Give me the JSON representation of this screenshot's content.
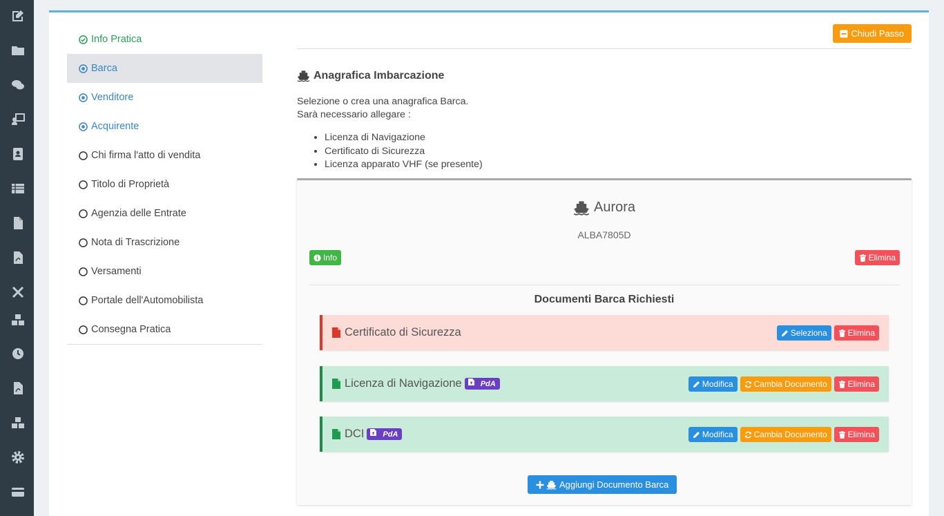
{
  "sidebar": {
    "icons": [
      "edit-icon",
      "folder-icon",
      "chat-icon",
      "presenter-icon",
      "address-book-icon",
      "list-table-icon",
      "file-icon",
      "pdf-file-icon",
      "tools-icon",
      "boxes-icon",
      "clock-icon",
      "pdf-file-icon-2",
      "boxes-icon-2",
      "gear-icon",
      "credit-card-icon"
    ]
  },
  "steps": [
    {
      "label": "Info Pratica",
      "state": "done"
    },
    {
      "label": "Barca",
      "state": "active"
    },
    {
      "label": "Venditore",
      "state": "current"
    },
    {
      "label": "Acquirente",
      "state": "current"
    },
    {
      "label": "Chi firma l'atto di vendita",
      "state": "todo"
    },
    {
      "label": "Titolo di Proprietà",
      "state": "todo"
    },
    {
      "label": "Agenzia delle Entrate",
      "state": "todo"
    },
    {
      "label": "Nota di Trascrizione",
      "state": "todo"
    },
    {
      "label": "Versamenti",
      "state": "todo"
    },
    {
      "label": "Portale dell'Automobilista",
      "state": "todo"
    },
    {
      "label": "Consegna Pratica",
      "state": "todo"
    }
  ],
  "header": {
    "close_step_label": "Chiudi Passo",
    "section_title": "Anagrafica Imbarcazione",
    "intro_line1": "Selezione o crea una anagrafica Barca.",
    "intro_line2": "Sarà necessario allegare :",
    "required": [
      "Licenza di Navigazione",
      "Certificato di Sicurezza",
      "Licenza apparato VHF (se presente)"
    ]
  },
  "boat": {
    "name": "Aurora",
    "code": "ALBA7805D",
    "info_label": "Info",
    "delete_label": "Elimina",
    "docs_title": "Documenti Barca Richiesti",
    "documents": [
      {
        "name": "Certificato di Sicurezza",
        "status": "missing",
        "badge": "",
        "actions": [
          "Seleziona",
          "Elimina"
        ]
      },
      {
        "name": "Licenza di Navigazione",
        "status": "ok",
        "badge": "PdA",
        "actions": [
          "Modifica",
          "Cambia Documento",
          "Elimina"
        ]
      },
      {
        "name": "DCI",
        "status": "ok",
        "badge": "PdA",
        "actions": [
          "Modifica",
          "Cambia Documento",
          "Elimina"
        ]
      }
    ],
    "add_doc_label": "Aggiungi Documento Barca"
  },
  "colors": {
    "rail": "#2f3c46",
    "accent_blue": "#2b8fe0",
    "orange": "#f89b0e",
    "red": "#f2515a",
    "green": "#41b546",
    "purple_badge": "#6a3fc4"
  }
}
